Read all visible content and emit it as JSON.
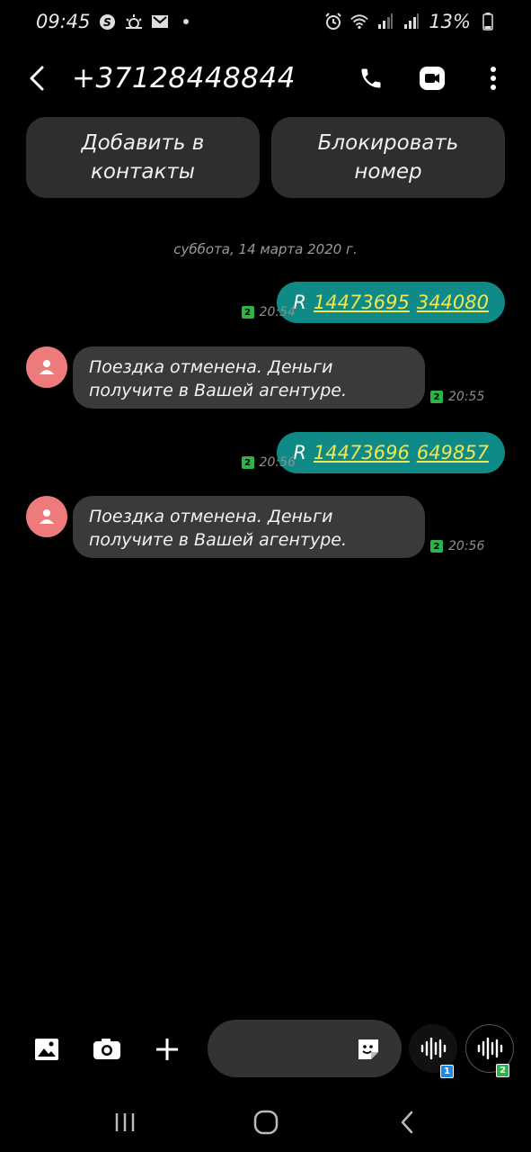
{
  "status_bar": {
    "time": "09:45",
    "battery": "13%",
    "left_icons": [
      "skype-icon",
      "weather-icon",
      "gmail-icon",
      "notification-dot-icon"
    ],
    "right_icons": [
      "alarm-icon",
      "wifi-icon",
      "signal-sim1-icon",
      "signal-sim2-icon",
      "battery-icon"
    ]
  },
  "header": {
    "title": "+37128448844"
  },
  "action_buttons": {
    "add_contact": "Добавить в контакты",
    "block_number": "Блокировать номер"
  },
  "conversation": {
    "date_separator": "суббота, 14 марта 2020 г.",
    "messages": [
      {
        "direction": "outgoing",
        "prefix": "R",
        "link1": "14473695",
        "link2": "344080",
        "sim": "2",
        "time": "20:54"
      },
      {
        "direction": "incoming",
        "text": "Поездка отменена. Деньги получите в Вашей агентуре.",
        "sim": "2",
        "time": "20:55"
      },
      {
        "direction": "outgoing",
        "prefix": "R",
        "link1": "14473696",
        "link2": "649857",
        "sim": "2",
        "time": "20:56"
      },
      {
        "direction": "incoming",
        "text": "Поездка отменена. Деньги получите в Вашей агентуре.",
        "sim": "2",
        "time": "20:56"
      }
    ]
  },
  "composer": {
    "placeholder": "",
    "voice_sim1_badge": "1",
    "voice_sim2_badge": "2"
  },
  "colors": {
    "outgoing_bubble": "#0f8a86",
    "incoming_bubble": "#3a3a3a",
    "link": "#f3e650",
    "avatar": "#ee7b7b",
    "sim_badge": "#2eb34a",
    "sim1_badge": "#1e88e5"
  }
}
